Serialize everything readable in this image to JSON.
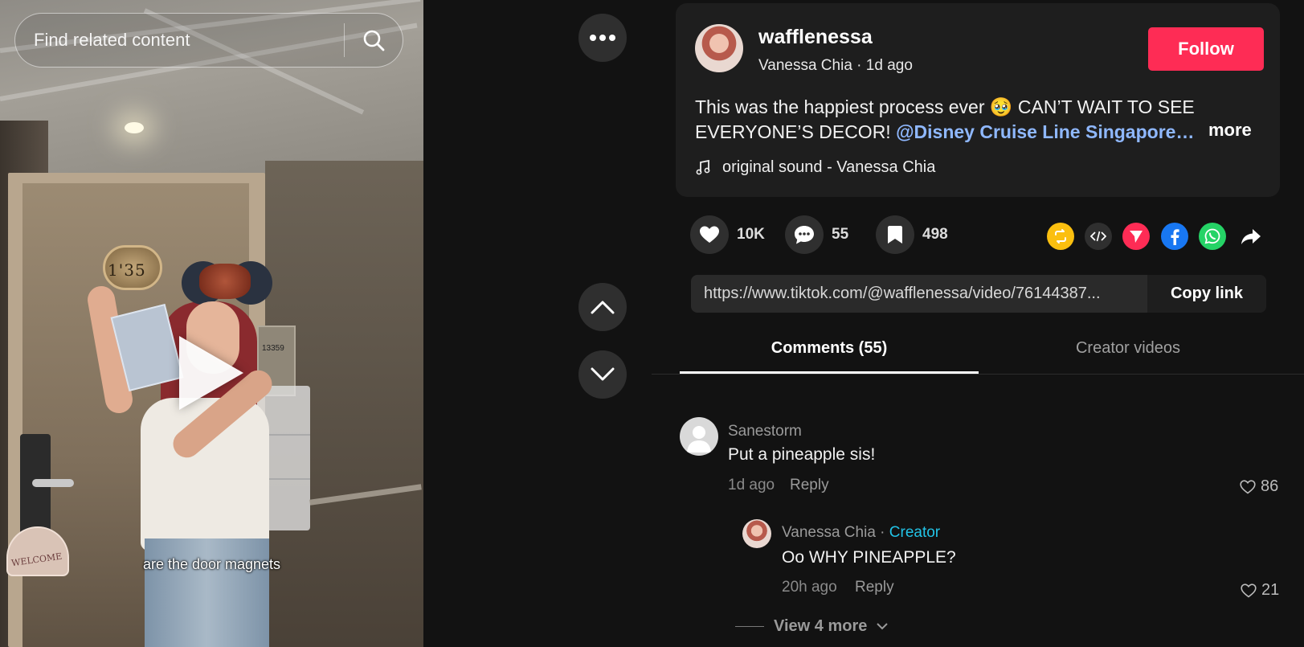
{
  "search": {
    "placeholder": "Find related content"
  },
  "video": {
    "caption": "are the door magnets",
    "door_number": "1'35",
    "placard_number": "13359",
    "welcome_sign": "WELCOME"
  },
  "post": {
    "username": "wafflenessa",
    "display_name": "Vanessa Chia",
    "time_ago": "1d ago",
    "follow_label": "Follow",
    "description": "This was the happiest process ever 🥹 CAN’T WAIT TO SEE EVERYONE’S DECOR! ",
    "mention": "@Disney Cruise Line Singapore…",
    "more_label": "more",
    "sound": "original sound - Vanessa Chia"
  },
  "actions": {
    "likes": "10K",
    "comments": "55",
    "saves": "498"
  },
  "share_icons": [
    "repost-icon",
    "embed-icon",
    "send-icon",
    "facebook-icon",
    "whatsapp-icon",
    "share-arrow-icon"
  ],
  "link": {
    "url": "https://www.tiktok.com/@wafflenessa/video/76144387...",
    "copy_label": "Copy link"
  },
  "tabs": {
    "comments": "Comments (55)",
    "creator_videos": "Creator videos"
  },
  "comments": [
    {
      "author": "Sanestorm",
      "text": "Put a pineapple sis!",
      "time": "1d ago",
      "reply_label": "Reply",
      "likes": "86"
    }
  ],
  "reply": {
    "author": "Vanessa Chia",
    "badge": "Creator",
    "text": "Oo WHY PINEAPPLE?",
    "time": "20h ago",
    "reply_label": "Reply",
    "likes": "21"
  },
  "view_more_label": "View 4 more",
  "colors": {
    "accent": "#fe2c55",
    "mention": "#8fb8ff",
    "creator_badge": "#22c3e6",
    "background": "#121212",
    "card": "#1e1e1e"
  }
}
